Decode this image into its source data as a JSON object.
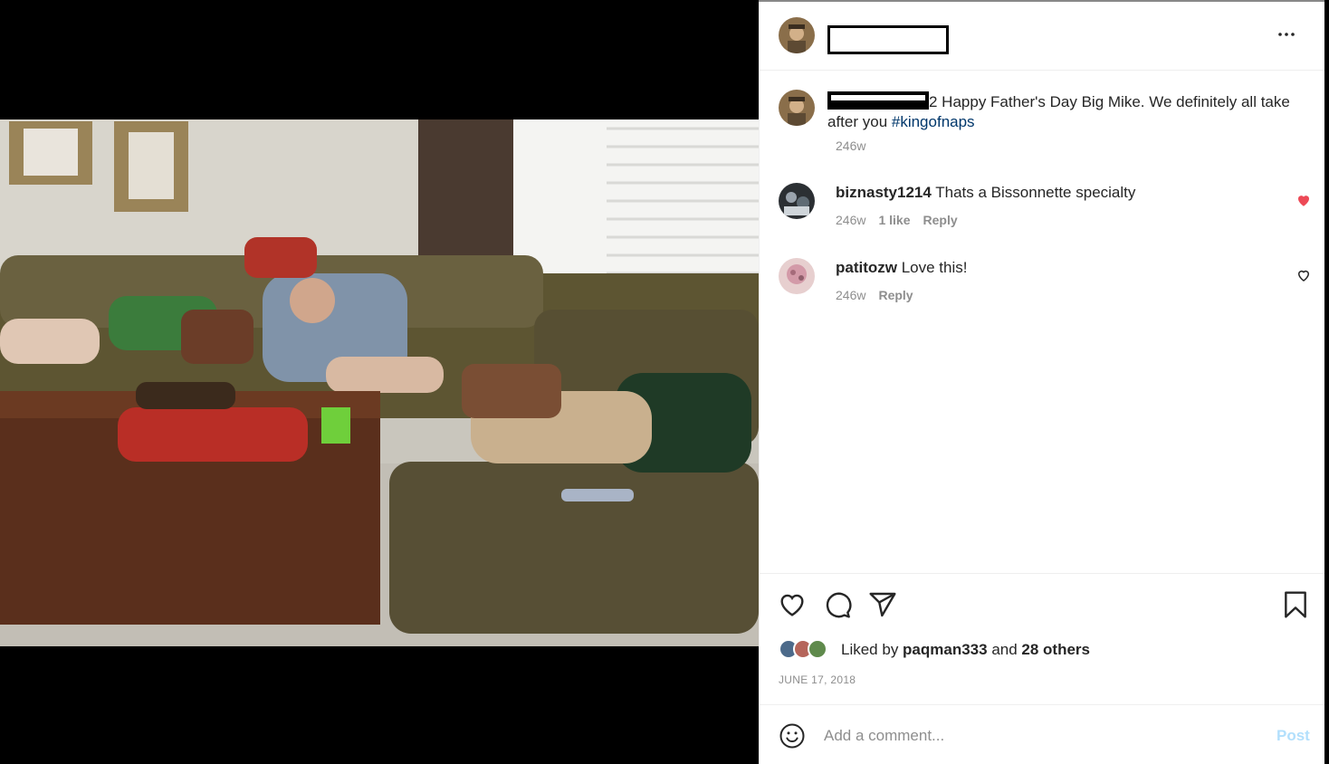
{
  "post": {
    "caption": "2 Happy Father's Day Big Mike. We definitely all take after you ",
    "hashtag": "#kingofnaps",
    "caption_time": "246w"
  },
  "comments": [
    {
      "username": "biznasty1214",
      "text": " Thats a Bissonnette specialty",
      "time": "246w",
      "likes": "1 like",
      "reply": "Reply",
      "liked": true
    },
    {
      "username": "patitozw",
      "text": " Love this!",
      "time": "246w",
      "reply": "Reply",
      "liked": false
    }
  ],
  "likes": {
    "prefix": "Liked by ",
    "user": "paqman333",
    "middle": " and ",
    "others": "28 others"
  },
  "date": "JUNE 17, 2018",
  "add_comment": {
    "placeholder": "Add a comment...",
    "post_label": "Post"
  },
  "icons": [
    "more-icon",
    "heart-icon",
    "comment-icon",
    "share-icon",
    "bookmark-icon",
    "emoji-icon"
  ],
  "colors": {
    "like_red": "#ed4956",
    "link_blue": "#00376b",
    "post_blue": "#b2dffc",
    "muted": "#8e8e8e"
  }
}
